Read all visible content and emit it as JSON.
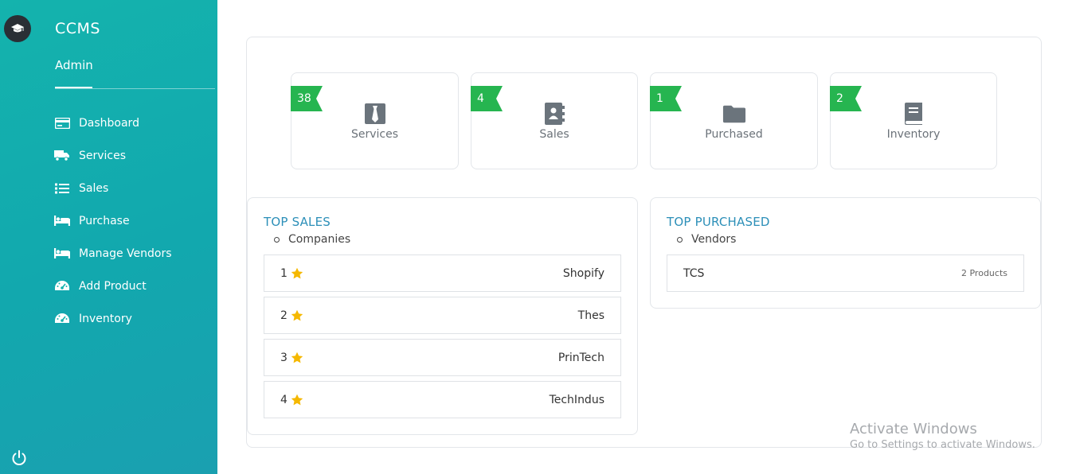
{
  "app": {
    "brand": "CCMS",
    "user_role": "Admin"
  },
  "sidebar": {
    "items": [
      {
        "label": "Dashboard",
        "icon": "credit-card-icon"
      },
      {
        "label": "Services",
        "icon": "truck-icon"
      },
      {
        "label": "Sales",
        "icon": "list-icon"
      },
      {
        "label": "Purchase",
        "icon": "bed-icon"
      },
      {
        "label": "Manage Vendors",
        "icon": "bed-icon"
      },
      {
        "label": "Add Product",
        "icon": "gauge-icon"
      },
      {
        "label": "Inventory",
        "icon": "gauge-icon"
      }
    ]
  },
  "stats": [
    {
      "count": "38",
      "label": "Services",
      "icon": "tie-icon"
    },
    {
      "count": "4",
      "label": "Sales",
      "icon": "address-book-icon"
    },
    {
      "count": "1",
      "label": "Purchased",
      "icon": "folder-icon"
    },
    {
      "count": "2",
      "label": "Inventory",
      "icon": "book-icon"
    }
  ],
  "top_sales": {
    "title": "TOP SALES",
    "subtitle": "Companies",
    "rows": [
      {
        "rank": "1",
        "name": "Shopify"
      },
      {
        "rank": "2",
        "name": "Thes"
      },
      {
        "rank": "3",
        "name": "PrinTech"
      },
      {
        "rank": "4",
        "name": "TechIndus"
      }
    ]
  },
  "top_purchased": {
    "title": "TOP PURCHASED",
    "subtitle": "Vendors",
    "rows": [
      {
        "name": "TCS",
        "meta": "2 Products"
      }
    ]
  },
  "watermark": {
    "line1": "Activate Windows",
    "line2": "Go to Settings to activate Windows."
  },
  "colors": {
    "sidebar": "#14b3ad",
    "ribbon": "#26b550",
    "title": "#2c8fb8",
    "star": "#f5b800"
  }
}
